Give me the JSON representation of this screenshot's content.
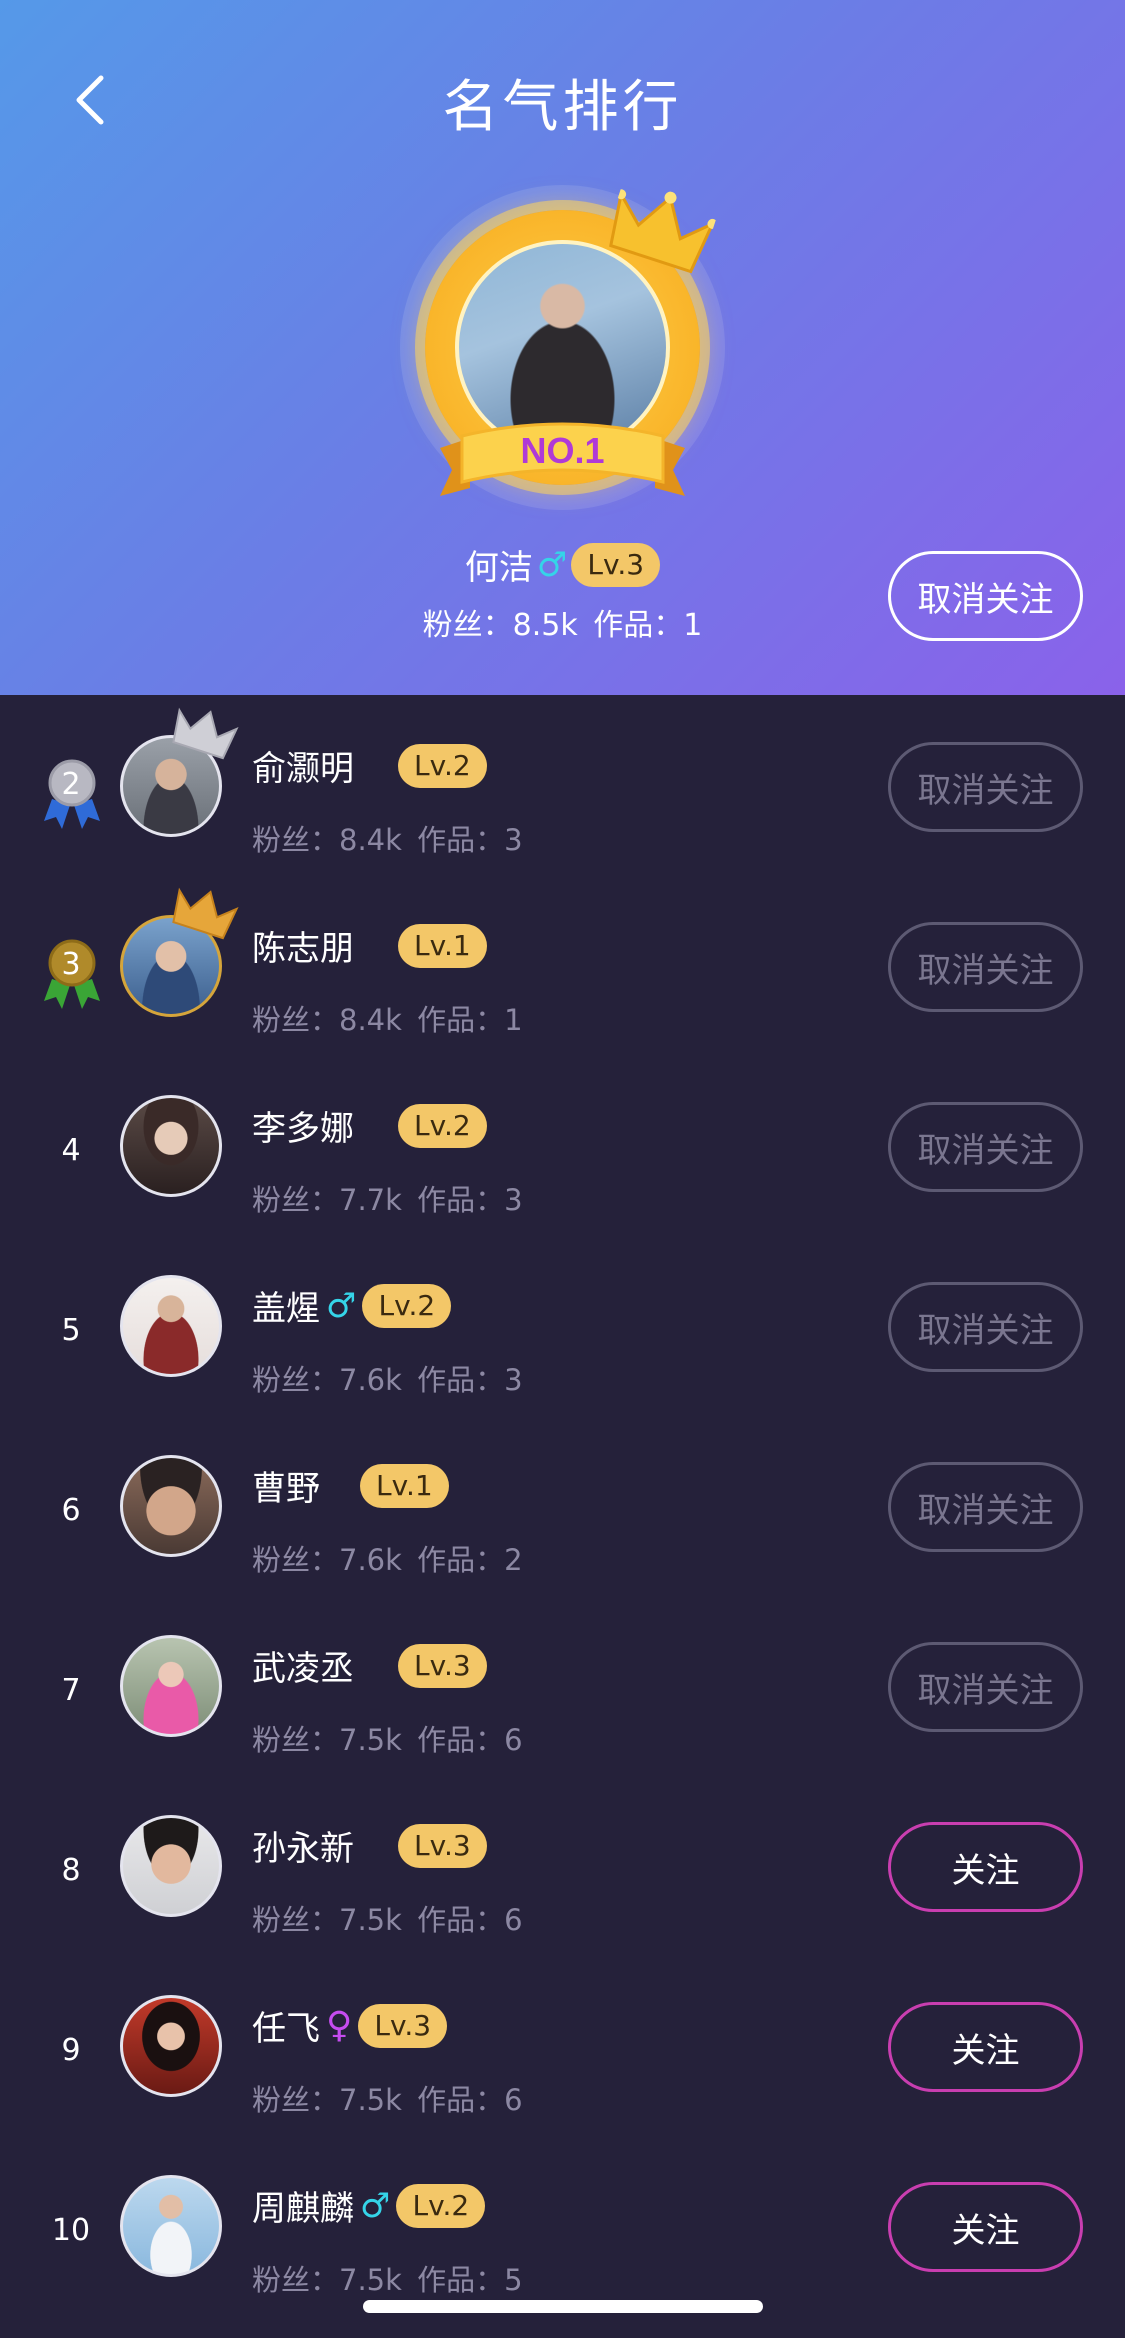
{
  "header": {
    "title": "名气排行",
    "back_icon": "chevron-left-icon"
  },
  "top": {
    "rank_label": "NO.1",
    "name": "何洁",
    "gender": "♂",
    "level": "Lv.3",
    "stats": "粉丝：8.5k   作品：1",
    "follow_label": "取消关注"
  },
  "list": [
    {
      "rank": "2",
      "name": "俞灏明",
      "gender": "",
      "level": "Lv.2",
      "stats": "粉丝：8.4k   作品：3",
      "button": "取消关注"
    },
    {
      "rank": "3",
      "name": "陈志朋",
      "gender": "",
      "level": "Lv.1",
      "stats": "粉丝：8.4k   作品：1",
      "button": "取消关注"
    },
    {
      "rank": "4",
      "name": "李多娜",
      "gender": "",
      "level": "Lv.2",
      "stats": "粉丝：7.7k   作品：3",
      "button": "取消关注"
    },
    {
      "rank": "5",
      "name": "盖煋",
      "gender": "♂",
      "level": "Lv.2",
      "stats": "粉丝：7.6k   作品：3",
      "button": "取消关注"
    },
    {
      "rank": "6",
      "name": "曹野",
      "gender": "",
      "level": "Lv.1",
      "stats": "粉丝：7.6k   作品：2",
      "button": "取消关注"
    },
    {
      "rank": "7",
      "name": "武凌丞",
      "gender": "",
      "level": "Lv.3",
      "stats": "粉丝：7.5k   作品：6",
      "button": "取消关注"
    },
    {
      "rank": "8",
      "name": "孙永新",
      "gender": "",
      "level": "Lv.3",
      "stats": "粉丝：7.5k   作品：6",
      "button": "关注"
    },
    {
      "rank": "9",
      "name": "任飞",
      "gender": "♀",
      "level": "Lv.3",
      "stats": "粉丝：7.5k   作品：6",
      "button": "关注"
    },
    {
      "rank": "10",
      "name": "周麒麟",
      "gender": "♂",
      "level": "Lv.2",
      "stats": "粉丝：7.5k   作品：5",
      "button": "关注"
    }
  ],
  "colors": {
    "header_gradient_start": "#5599e8",
    "header_gradient_end": "#8a62ea",
    "list_background": "#25213a",
    "level_badge": "#f3c768",
    "follow_border": "#c93eb0",
    "male": "#35d4e8",
    "female": "#c64cf0"
  }
}
